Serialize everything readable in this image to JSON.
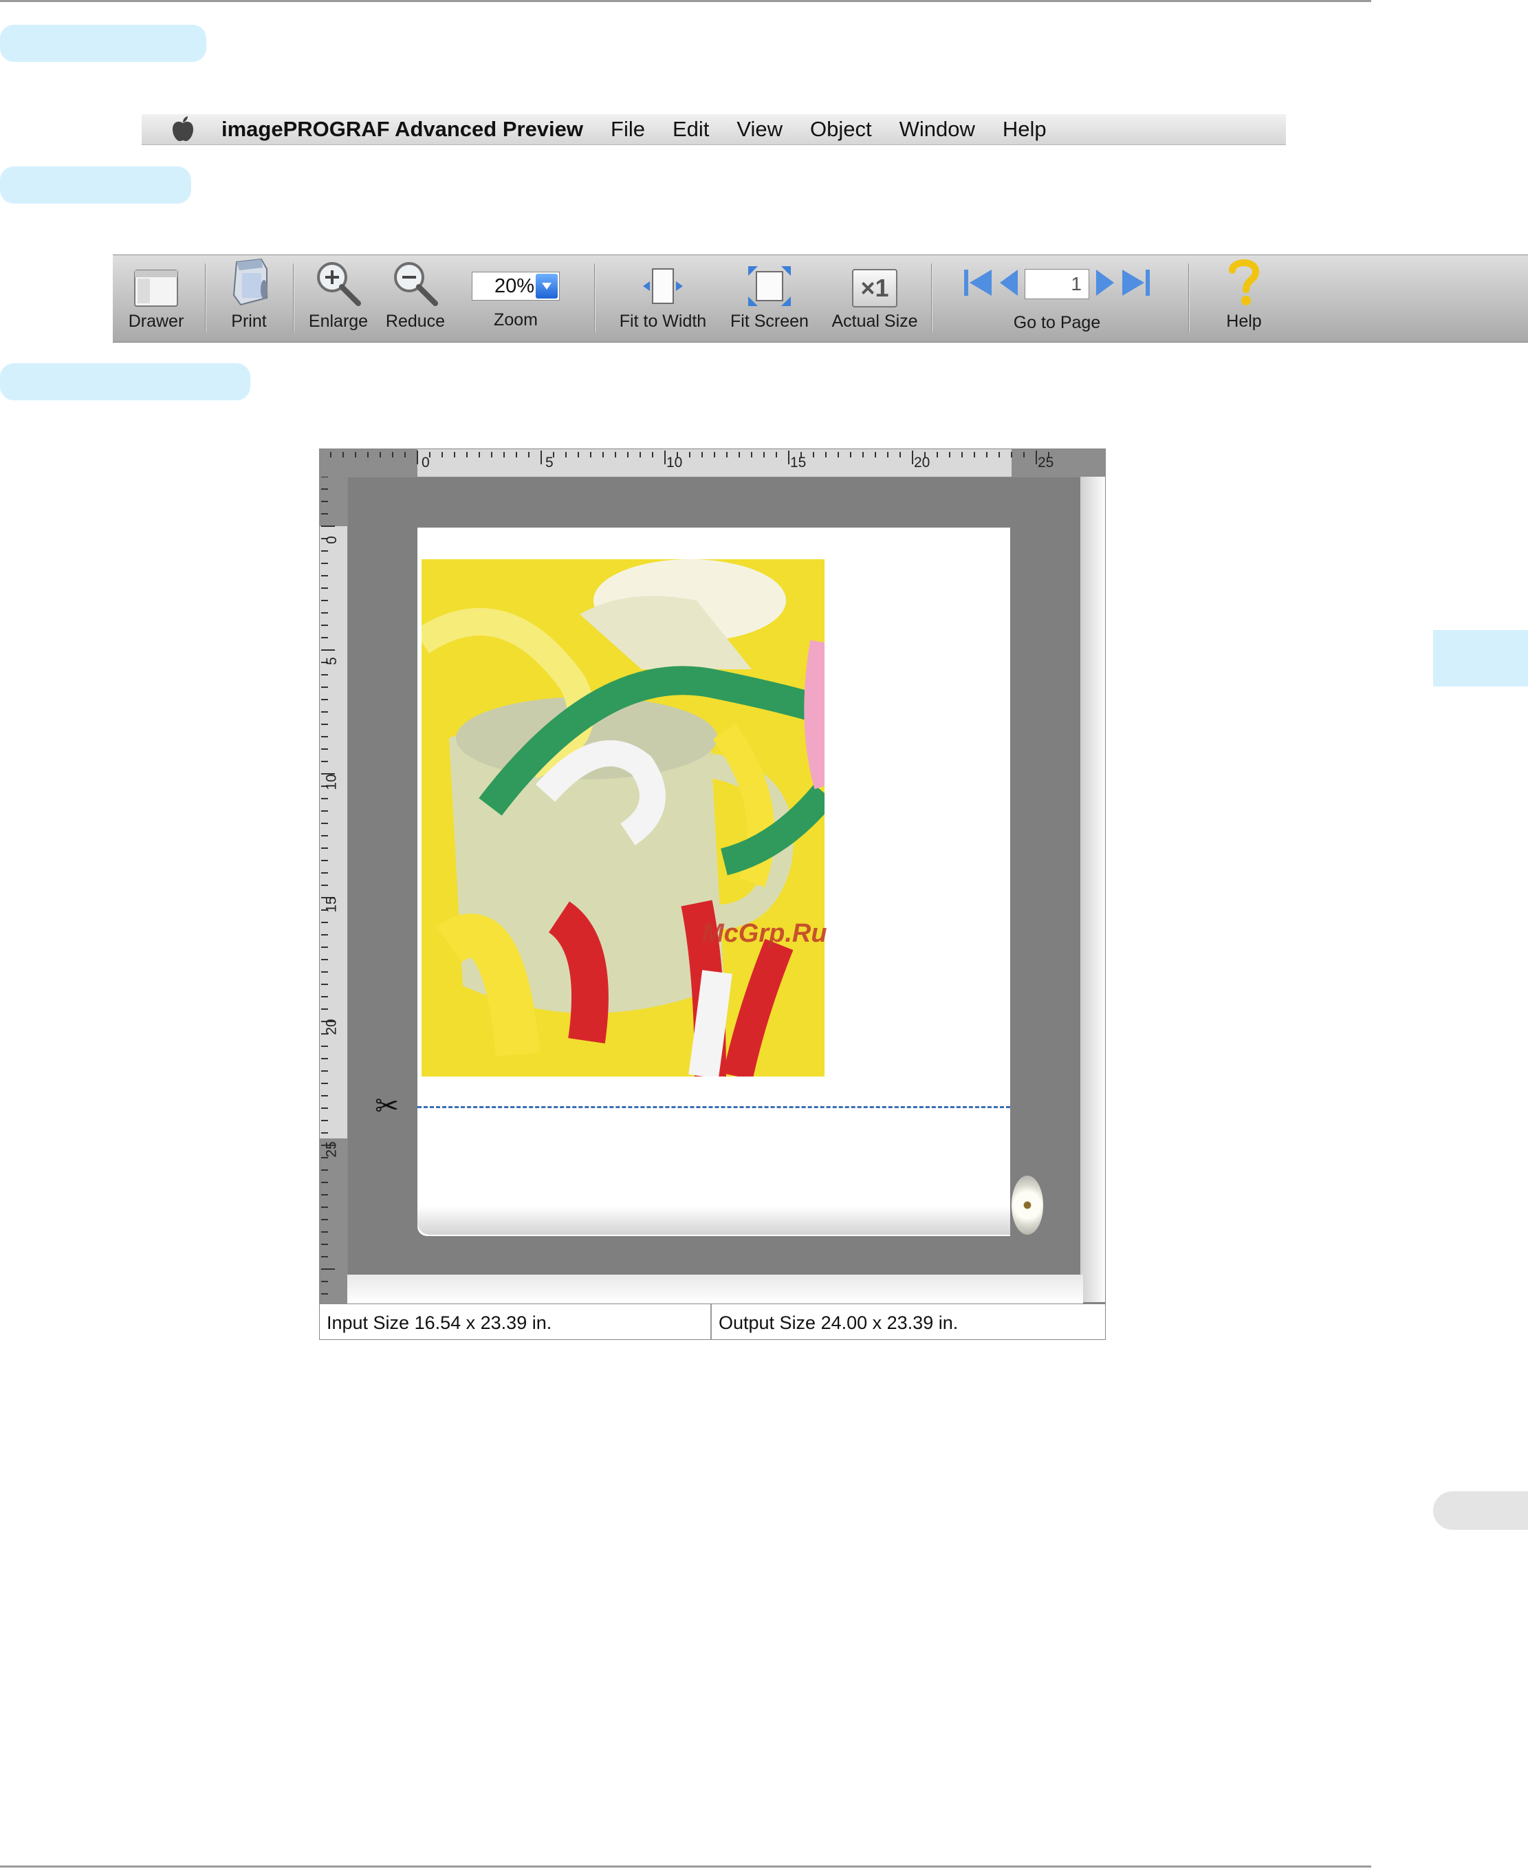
{
  "menubar": {
    "apple_icon": "apple-icon",
    "app_name": "imagePROGRAF Advanced Preview",
    "items": [
      "File",
      "Edit",
      "View",
      "Object",
      "Window",
      "Help"
    ]
  },
  "toolbar": {
    "drawer_label": "Drawer",
    "print_label": "Print",
    "enlarge_label": "Enlarge",
    "reduce_label": "Reduce",
    "zoom_value": "20%",
    "zoom_label": "Zoom",
    "fit_width_label": "Fit to Width",
    "fit_screen_label": "Fit Screen",
    "actual_size_label": "Actual Size",
    "actual_size_glyph": "×1",
    "page_value": "1",
    "go_to_page_label": "Go to Page",
    "help_label": "Help"
  },
  "preview": {
    "ruler_h_labels": [
      "0",
      "5",
      "10",
      "15",
      "20",
      "25"
    ],
    "ruler_v_labels": [
      "0",
      "5",
      "10",
      "15",
      "20",
      "25"
    ],
    "watermark": "McGrp.Ru"
  },
  "status": {
    "input_size": "Input Size 16.54 x 23.39 in.",
    "output_size": "Output Size 24.00 x 23.39 in."
  },
  "colors": {
    "heading_pill": "#d4f0fd",
    "cut_line": "#3a6fb5",
    "photo_background": "#f1de2f"
  }
}
